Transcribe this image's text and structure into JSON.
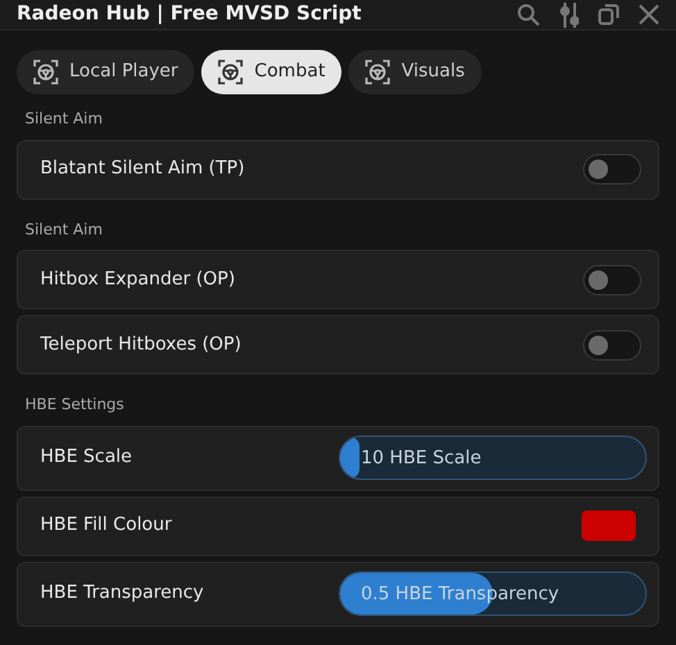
{
  "window": {
    "title": "Radeon Hub | Free MVSD Script"
  },
  "tabs": [
    {
      "label": "Local Player",
      "selected": false
    },
    {
      "label": "Combat",
      "selected": true
    },
    {
      "label": "Visuals",
      "selected": false
    }
  ],
  "sections": [
    {
      "title": "Silent Aim",
      "items": [
        {
          "kind": "toggle",
          "label": "Blatant Silent Aim (TP)",
          "on": false
        }
      ]
    },
    {
      "title": "Silent Aim",
      "items": [
        {
          "kind": "toggle",
          "label": "Hitbox Expander (OP)",
          "on": false
        },
        {
          "kind": "toggle",
          "label": "Teleport Hitboxes (OP)",
          "on": false
        }
      ]
    },
    {
      "title": "HBE Settings",
      "items": [
        {
          "kind": "slider",
          "label": "HBE Scale",
          "value": "10 HBE Scale",
          "level": 0.03
        },
        {
          "kind": "color",
          "label": "HBE Fill Colour",
          "color": "#cc0000"
        },
        {
          "kind": "slider",
          "label": "HBE Transparency",
          "value": "0.5 HBE Transparency",
          "level": 0.5
        }
      ]
    }
  ]
}
